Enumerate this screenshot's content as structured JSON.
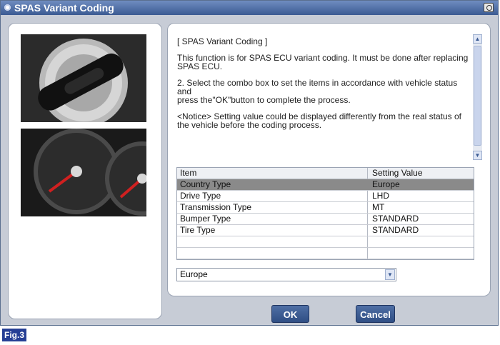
{
  "window": {
    "title": "SPAS Variant Coding"
  },
  "images": {
    "ignition": "ignition-key-cylinder",
    "gauge": "instrument-cluster-gauges"
  },
  "description": {
    "paragraphs": [
      "[ SPAS Variant Coding ]",
      "This function is for SPAS ECU variant coding. It must be done after replacing SPAS ECU.",
      "2. Select the combo box to set the items in accordance with vehicle status and\n press the\"OK\"button to complete the process.",
      "<Notice> Setting value could be displayed differently from the real status of\n the vehicle before the coding process."
    ]
  },
  "table": {
    "headers": [
      "Item",
      "Setting Value"
    ],
    "rows": [
      {
        "item": "Country Type",
        "value": "Europe",
        "selected": true
      },
      {
        "item": "Drive Type",
        "value": "LHD",
        "selected": false
      },
      {
        "item": "Transmission Type",
        "value": "MT",
        "selected": false
      },
      {
        "item": "Bumper Type",
        "value": "STANDARD",
        "selected": false
      },
      {
        "item": "Tire Type",
        "value": "STANDARD",
        "selected": false
      }
    ]
  },
  "combo": {
    "value": "Europe"
  },
  "buttons": {
    "ok": "OK",
    "cancel": "Cancel"
  },
  "figure_label": "Fig.3",
  "colors": {
    "title_bar": "#3b5b93",
    "button": "#2f4e84",
    "selected_row": "#8a8a8a",
    "figure_tag": "#263f95"
  }
}
